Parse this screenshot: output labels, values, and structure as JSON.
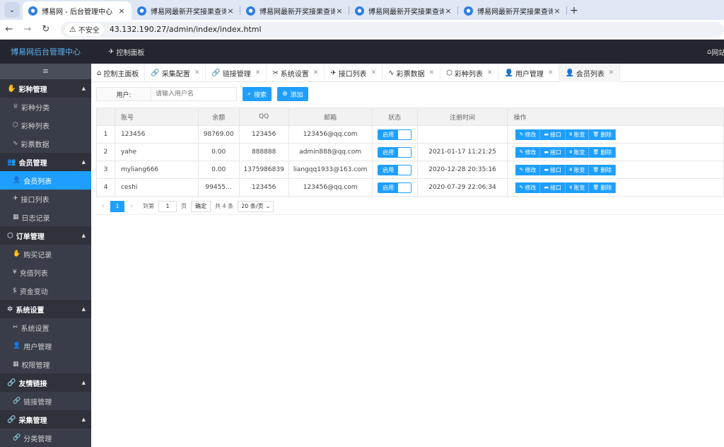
{
  "browser": {
    "tabs": [
      {
        "title": "博易网 - 后台管理中心",
        "active": true
      },
      {
        "title": "博易网最新开奖接果查询,重庆时",
        "active": false
      },
      {
        "title": "博易网最新开奖接果查询,重庆时",
        "active": false
      },
      {
        "title": "博易网最新开奖接果查询,重庆时",
        "active": false
      },
      {
        "title": "博易网最新开奖接果查询,重庆时",
        "active": false
      }
    ],
    "insecure_label": "不安全",
    "url": "43.132.190.27/admin/index/index.html"
  },
  "app": {
    "brand": "博易网后台管理中心",
    "top_nav": "控制面板",
    "top_right": "网站"
  },
  "sidebar": {
    "groups": [
      {
        "label": "彩种管理",
        "icon": "hand-icon",
        "items": [
          {
            "label": "彩种分类",
            "icon": "crown-icon"
          },
          {
            "label": "彩种列表",
            "icon": "cube-icon"
          },
          {
            "label": "彩票数据",
            "icon": "pulse-icon"
          }
        ]
      },
      {
        "label": "会员管理",
        "icon": "users-icon",
        "items": [
          {
            "label": "会员列表",
            "icon": "user-icon",
            "active": true
          },
          {
            "label": "接口列表",
            "icon": "send-icon"
          },
          {
            "label": "日志记录",
            "icon": "calendar-icon"
          }
        ]
      },
      {
        "label": "订单管理",
        "icon": "cube-icon",
        "items": [
          {
            "label": "购买记录",
            "icon": "hand-icon"
          },
          {
            "label": "充值列表",
            "icon": "yen-icon"
          },
          {
            "label": "资金变动",
            "icon": "dollar-icon"
          }
        ]
      },
      {
        "label": "系统设置",
        "icon": "gear-icon",
        "items": [
          {
            "label": "系统设置",
            "icon": "tools-icon"
          },
          {
            "label": "用户管理",
            "icon": "user-icon"
          },
          {
            "label": "权限管理",
            "icon": "calendar-icon"
          }
        ]
      },
      {
        "label": "友情链接",
        "icon": "link-icon",
        "items": [
          {
            "label": "链接管理",
            "icon": "link-icon"
          }
        ]
      },
      {
        "label": "采集管理",
        "icon": "link-icon",
        "items": [
          {
            "label": "分类管理",
            "icon": "link-icon"
          }
        ]
      }
    ]
  },
  "content_tabs": [
    {
      "label": "控制主面板",
      "icon": "home-icon",
      "closable": false
    },
    {
      "label": "采集配置",
      "icon": "link-icon",
      "closable": true
    },
    {
      "label": "链接管理",
      "icon": "link-icon",
      "closable": true
    },
    {
      "label": "系统设置",
      "icon": "tools-icon",
      "closable": true
    },
    {
      "label": "接口列表",
      "icon": "send-icon",
      "closable": true
    },
    {
      "label": "彩票数据",
      "icon": "pulse-icon",
      "closable": true
    },
    {
      "label": "彩种列表",
      "icon": "cube-icon",
      "closable": true
    },
    {
      "label": "用户管理",
      "icon": "user-icon",
      "closable": true
    },
    {
      "label": "会员列表",
      "icon": "user-icon",
      "closable": true,
      "active": true
    }
  ],
  "search": {
    "label": "用户:",
    "placeholder": "请输入用户名",
    "search_btn": "搜索",
    "add_btn": "添加"
  },
  "table": {
    "headers": [
      "",
      "账号",
      "余额",
      "QQ",
      "邮箱",
      "状态",
      "注册时间",
      "操作"
    ],
    "status_label": "启用",
    "actions": [
      "修改",
      "接口",
      "账变",
      "删除"
    ],
    "rows": [
      {
        "no": "1",
        "account": "123456",
        "balance": "98769.00",
        "qq": "123456",
        "email": "123456@qq.com",
        "time": ""
      },
      {
        "no": "2",
        "account": "yahe",
        "balance": "0.00",
        "qq": "888888",
        "email": "admin888@qq.com",
        "time": "2021-01-17 11:21:25"
      },
      {
        "no": "3",
        "account": "myliang666",
        "balance": "0.00",
        "qq": "1375986839",
        "email": "liangqq1933@163.com",
        "time": "2020-12-28 20:35:16"
      },
      {
        "no": "4",
        "account": "ceshi",
        "balance": "99455…",
        "qq": "123456",
        "email": "123456@qq.com",
        "time": "2020-07-29 22:06:34"
      }
    ]
  },
  "pager": {
    "current": "1",
    "goto_label": "到第",
    "goto_value": "1",
    "page_label": "页",
    "confirm": "确定",
    "total": "共 4 条",
    "page_size": "20 条/页"
  }
}
